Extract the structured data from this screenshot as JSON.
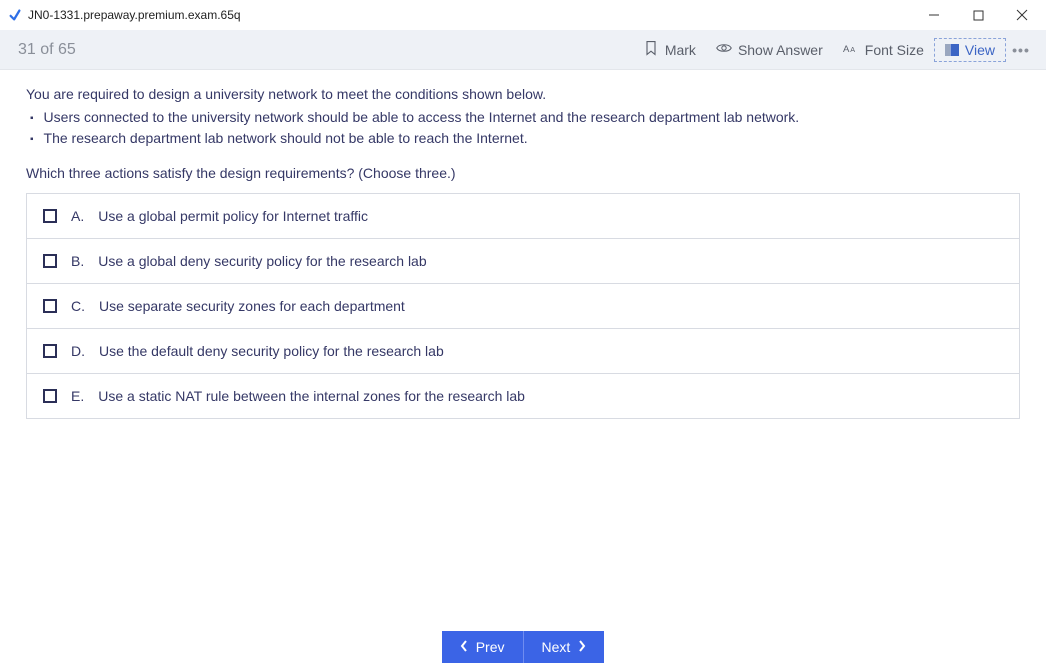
{
  "window": {
    "title": "JN0-1331.prepaway.premium.exam.65q"
  },
  "toolbar": {
    "progress": "31 of 65",
    "mark": "Mark",
    "show_answer": "Show Answer",
    "font_size": "Font Size",
    "view": "View"
  },
  "question": {
    "stem_intro": "You are required to design a university network to meet the conditions shown below.",
    "bullets": [
      "Users connected to the university network should be able to access the Internet and the research department lab network.",
      "The research department lab network should not be able to reach the Internet."
    ],
    "prompt": "Which three actions satisfy the design requirements? (Choose three.)",
    "choices": [
      {
        "letter": "A.",
        "text": "Use a global permit policy for Internet traffic",
        "checked": false
      },
      {
        "letter": "B.",
        "text": "Use a global deny security policy for the research lab",
        "checked": false
      },
      {
        "letter": "C.",
        "text": "Use separate security zones for each department",
        "checked": false
      },
      {
        "letter": "D.",
        "text": "Use the default deny security policy for the research lab",
        "checked": false
      },
      {
        "letter": "E.",
        "text": "Use a static NAT rule between the internal zones for the research lab",
        "checked": false
      }
    ]
  },
  "nav": {
    "prev": "Prev",
    "next": "Next"
  }
}
